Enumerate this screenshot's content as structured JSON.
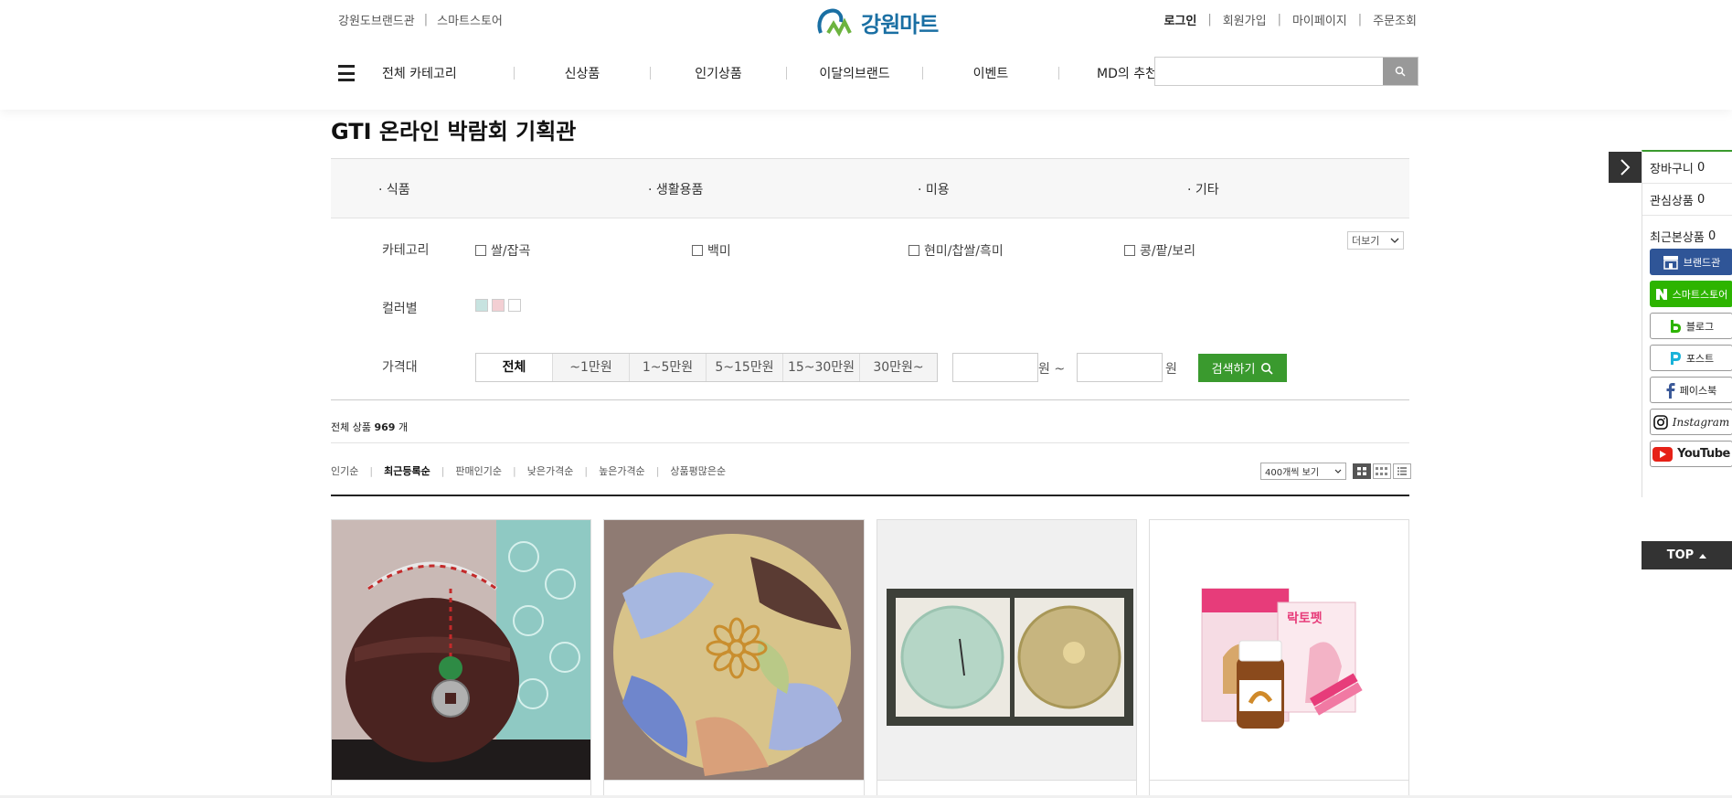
{
  "header": {
    "top_links": [
      "강원도브랜드관",
      "스마트스토어"
    ],
    "logo_text": "강원마트",
    "user_links": [
      "로그인",
      "회원가입",
      "마이페이지",
      "주문조회"
    ],
    "gnb": [
      "전체 카테고리",
      "신상품",
      "인기상품",
      "이달의브랜드",
      "이벤트",
      "MD의 추천"
    ],
    "search_placeholder": ""
  },
  "page_title": "GTI 온라인 박람회 기획관",
  "filter": {
    "categories": [
      "· 식품",
      "· 생활용품",
      "· 미용",
      "· 기타"
    ],
    "category_label": "카테고리",
    "subcategories": [
      "쌀/잡곡",
      "백미",
      "현미/찹쌀/흑미",
      "콩/팥/보리"
    ],
    "more_label": "더보기",
    "color_label": "컬러별",
    "colors": [
      "#c7e3e0",
      "#f3cfd3",
      "#ffffff"
    ],
    "price_label": "가격대",
    "price_tabs": [
      "전체",
      "~1만원",
      "1~5만원",
      "5~15만원",
      "15~30만원",
      "30만원~"
    ],
    "price_active": "전체",
    "won_from": "원 ~",
    "won_to": "원",
    "search_button": "검색하기"
  },
  "listing": {
    "total_prefix": "전체 상품",
    "total_count": "969",
    "total_suffix": "개",
    "sort_options": [
      "인기순",
      "최근등록순",
      "판매인기순",
      "낮은가격순",
      "높은가격순",
      "상품평많은순"
    ],
    "sort_active": "최근등록순",
    "per_page": "400개씩 보기"
  },
  "products": [
    {
      "name": "pouch-jar-product"
    },
    {
      "name": "marble-soap-product"
    },
    {
      "name": "soap-gift-set-product"
    },
    {
      "name": "lactopet-product",
      "brand_text": "락토펫"
    }
  ],
  "quickbar": {
    "cart_label": "장바구니",
    "cart_count": "0",
    "wish_label": "관심상품",
    "wish_count": "0",
    "recent_label": "최근본상품",
    "recent_count": "0",
    "brand_label": "브랜드관",
    "smartstore_label": "스마트스토어",
    "blog_label": "블로그",
    "post_label": "포스트",
    "facebook_label": "페이스북",
    "instagram_label": "Instagram",
    "youtube_label": "YouTube",
    "top_label": "TOP"
  }
}
